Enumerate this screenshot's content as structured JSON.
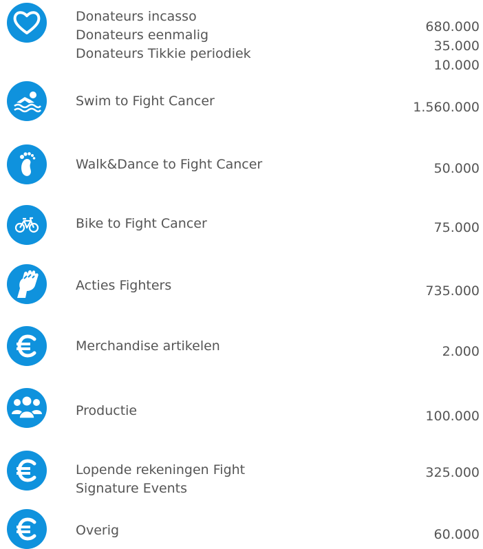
{
  "rows": [
    {
      "icon": "heart-icon",
      "labels": [
        "Donateurs incasso",
        "Donateurs eenmalig",
        "Donateurs Tikkie periodiek"
      ],
      "amounts": [
        "680.000",
        "35.000",
        "10.000"
      ]
    },
    {
      "icon": "swimmer-icon",
      "labels": [
        "Swim to Fight Cancer"
      ],
      "amounts": [
        "1.560.000"
      ]
    },
    {
      "icon": "footprint-icon",
      "labels": [
        "Walk&Dance to Fight Cancer"
      ],
      "amounts": [
        "50.000"
      ]
    },
    {
      "icon": "bicycle-icon",
      "labels": [
        "Bike to Fight Cancer"
      ],
      "amounts": [
        "75.000"
      ]
    },
    {
      "icon": "raised-fist-icon",
      "labels": [
        "Acties Fighters"
      ],
      "amounts": [
        "735.000"
      ]
    },
    {
      "icon": "euro-icon",
      "labels": [
        "Merchandise artikelen"
      ],
      "amounts": [
        "2.000"
      ]
    },
    {
      "icon": "group-icon",
      "labels": [
        "Productie"
      ],
      "amounts": [
        "100.000"
      ]
    },
    {
      "icon": "euro-icon",
      "labels": [
        "Lopende rekeningen Fight",
        "Signature Events"
      ],
      "amounts": [
        "325.000"
      ]
    },
    {
      "icon": "euro-icon",
      "labels": [
        "Overig"
      ],
      "amounts": [
        "60.000"
      ]
    }
  ],
  "colors": {
    "icon_bg": "#0f92dd",
    "text": "#555555"
  }
}
